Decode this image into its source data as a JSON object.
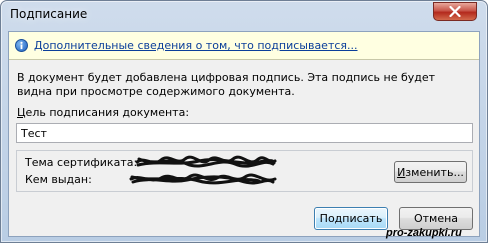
{
  "window": {
    "title": "Подписание",
    "close_icon": "close-x-icon"
  },
  "infobar": {
    "icon": "info-icon",
    "link_text": "Дополнительные сведения о том, что подписывается..."
  },
  "description": "В документ будет добавлена цифровая подпись. Эта подпись не будет видна при просмотре содержимого документа.",
  "purpose": {
    "label_underlined": "Ц",
    "label_rest": "ель подписания документа:",
    "value": "Тест"
  },
  "certificate": {
    "subject_label": "Тема сертификата:",
    "issuer_label": "Кем выдан:",
    "change_label_underlined": "И",
    "change_label_rest": "зменить..."
  },
  "buttons": {
    "sign_label": "Подписать",
    "cancel_label": "Отмена"
  },
  "watermark": "pro-zakupki.ru",
  "colors": {
    "link": "#0b3e9a",
    "infobar_bg": "#ffffe1",
    "close_button": "#c8564a",
    "default_button_border": "#3c7fb1"
  }
}
